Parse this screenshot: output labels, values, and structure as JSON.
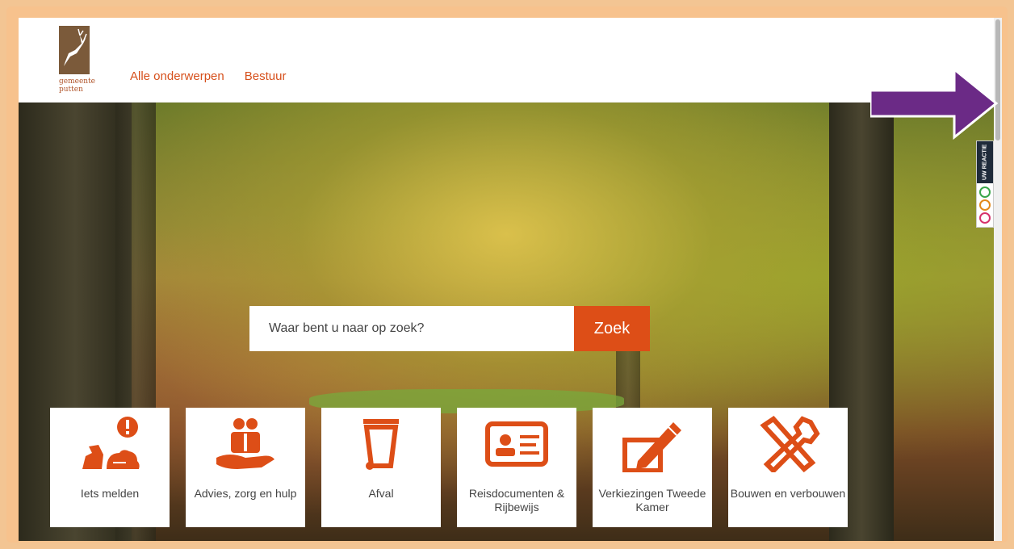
{
  "header": {
    "logo_text_1": "gemeente",
    "logo_text_2": "putten",
    "nav": [
      "Alle onderwerpen",
      "Bestuur"
    ]
  },
  "search": {
    "placeholder": "Waar bent u naar op zoek?",
    "button": "Zoek"
  },
  "tiles": [
    {
      "label": "Iets melden",
      "icon": "report-issue-icon"
    },
    {
      "label": "Advies, zorg en hulp",
      "icon": "care-hand-icon"
    },
    {
      "label": "Afval",
      "icon": "trash-bin-icon"
    },
    {
      "label": "Reisdocumenten & Rijbewijs",
      "icon": "id-card-icon"
    },
    {
      "label": "Verkiezingen Tweede Kamer",
      "icon": "ballot-pencil-icon"
    },
    {
      "label": "Bouwen en verbouwen",
      "icon": "hammer-wrench-icon"
    }
  ],
  "feedback": {
    "tag": "UW REACTIE",
    "faces": [
      "happy-face-icon",
      "neutral-face-icon",
      "sad-face-icon"
    ]
  },
  "colors": {
    "accent": "#dd4e17",
    "arrow": "#6b2a86",
    "frame": "#f7c28d"
  }
}
